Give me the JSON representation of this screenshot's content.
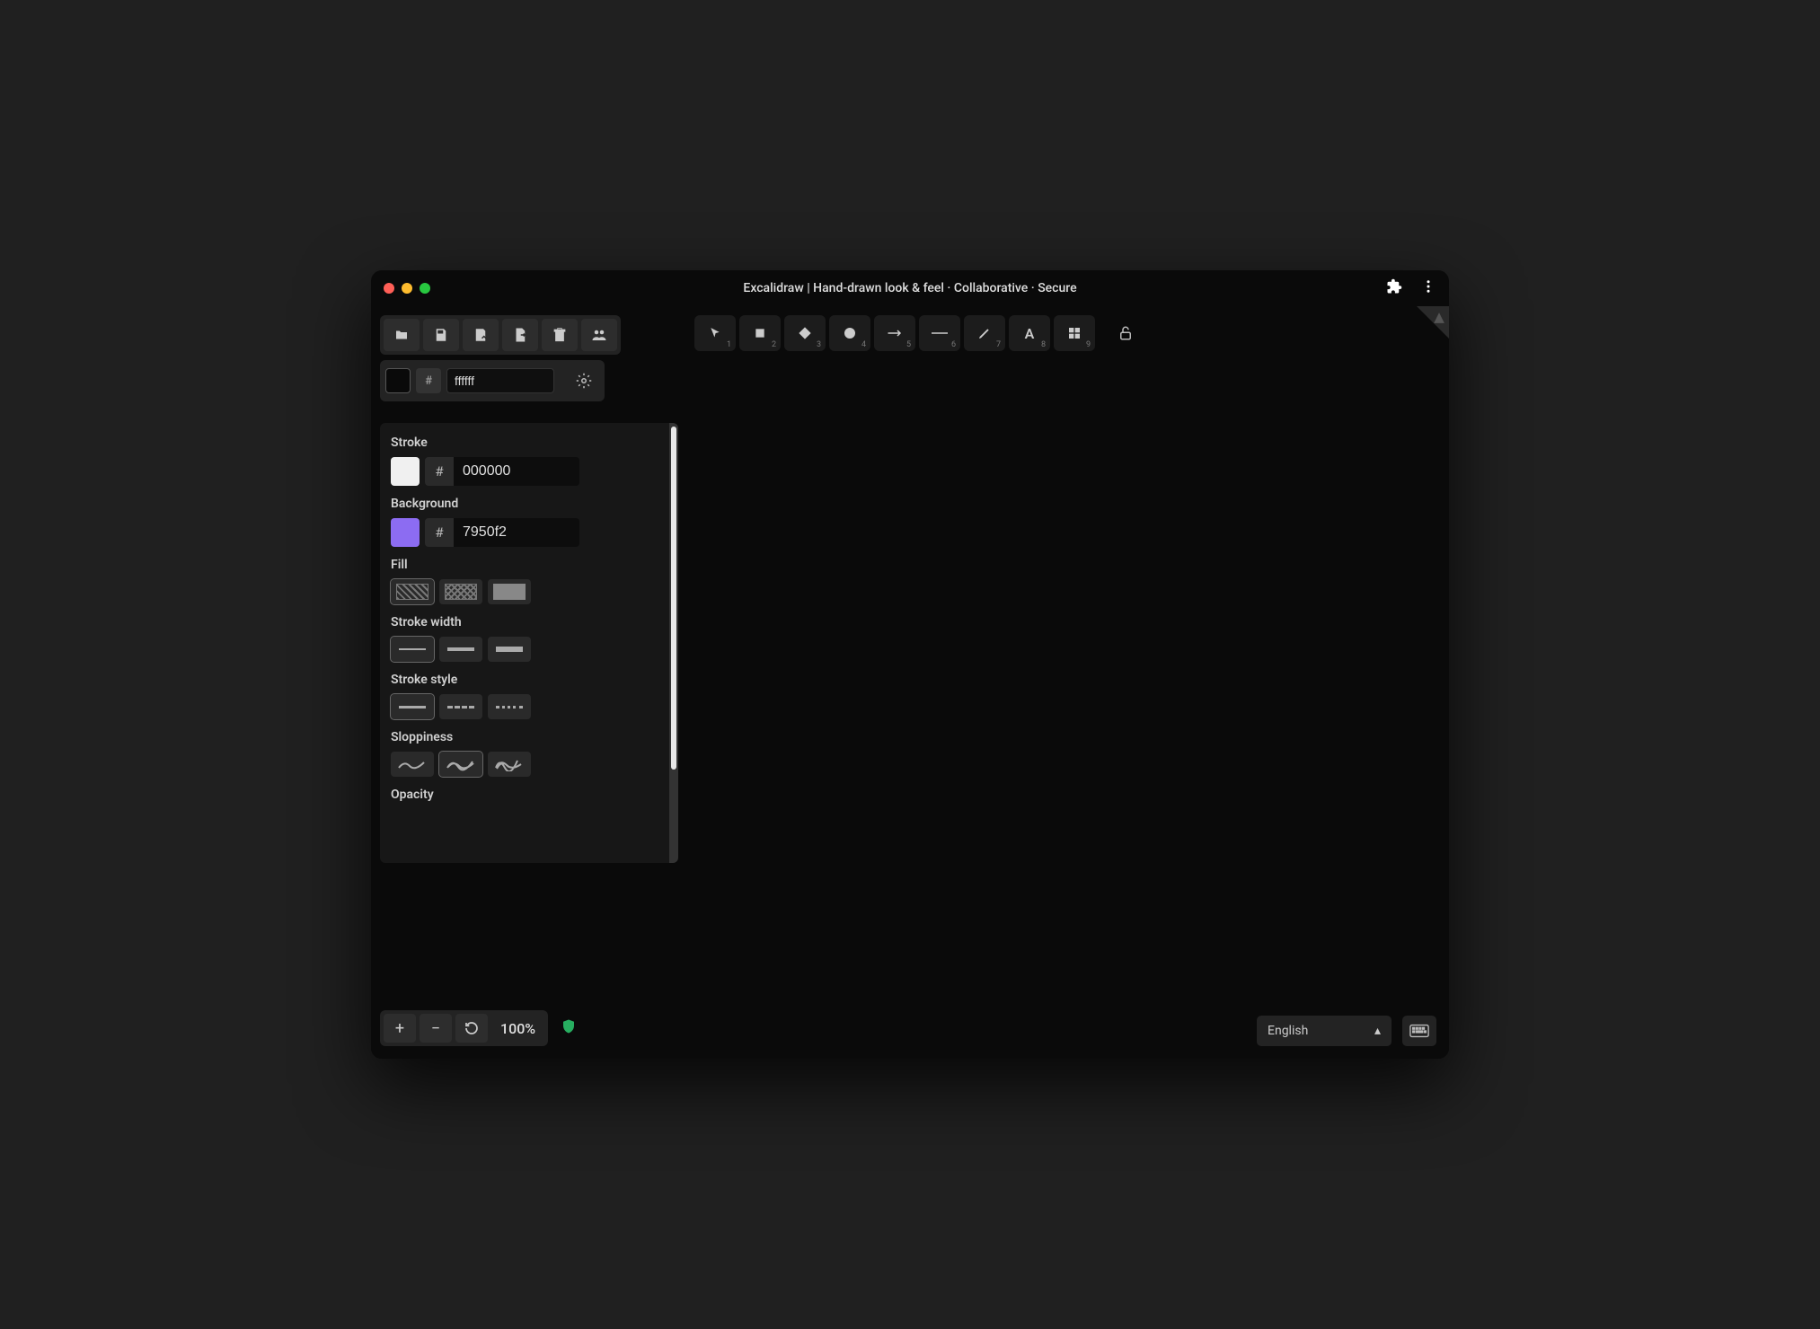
{
  "window": {
    "title": "Excalidraw | Hand-drawn look & feel · Collaborative · Secure"
  },
  "canvas_color": {
    "hash": "#",
    "value": "ffffff"
  },
  "tools": [
    {
      "name": "selection",
      "num": "1"
    },
    {
      "name": "rectangle",
      "num": "2"
    },
    {
      "name": "diamond",
      "num": "3"
    },
    {
      "name": "ellipse",
      "num": "4"
    },
    {
      "name": "arrow",
      "num": "5"
    },
    {
      "name": "line",
      "num": "6"
    },
    {
      "name": "draw",
      "num": "7"
    },
    {
      "name": "text",
      "num": "8"
    },
    {
      "name": "image",
      "num": "9"
    }
  ],
  "panel": {
    "stroke": {
      "label": "Stroke",
      "hash": "#",
      "value": "000000",
      "swatch": "#f0f0f0"
    },
    "background": {
      "label": "Background",
      "hash": "#",
      "value": "7950f2",
      "swatch": "#8c6cf2"
    },
    "fill": {
      "label": "Fill"
    },
    "stroke_width": {
      "label": "Stroke width"
    },
    "stroke_style": {
      "label": "Stroke style"
    },
    "sloppiness": {
      "label": "Sloppiness"
    },
    "opacity": {
      "label": "Opacity"
    }
  },
  "zoom": {
    "value": "100%"
  },
  "language": {
    "selected": "English"
  }
}
